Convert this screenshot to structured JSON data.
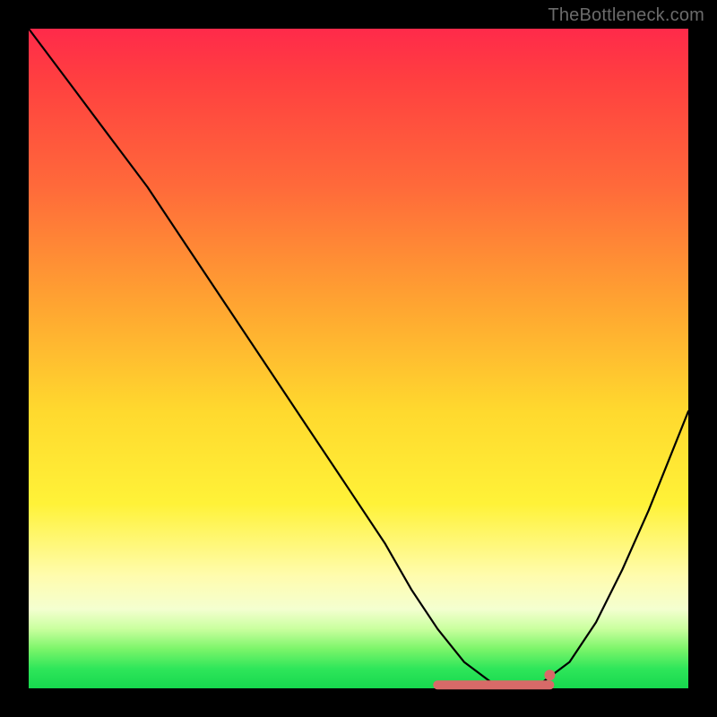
{
  "watermark": "TheBottleneck.com",
  "colors": {
    "frame": "#000000",
    "curve": "#000000",
    "fit_marker": "#d86a68",
    "gradient_top": "#ff2a4a",
    "gradient_bottom": "#16d84e"
  },
  "chart_data": {
    "type": "line",
    "title": "",
    "xlabel": "",
    "ylabel": "",
    "xlim": [
      0,
      100
    ],
    "ylim": [
      0,
      100
    ],
    "grid": false,
    "legend": false,
    "annotations": [
      "TheBottleneck.com"
    ],
    "series": [
      {
        "name": "bottleneck-curve",
        "x": [
          0,
          6,
          12,
          18,
          24,
          30,
          36,
          42,
          48,
          54,
          58,
          62,
          66,
          70,
          74,
          78,
          82,
          86,
          90,
          94,
          98,
          100
        ],
        "y": [
          100,
          92,
          84,
          76,
          67,
          58,
          49,
          40,
          31,
          22,
          15,
          9,
          4,
          1,
          0,
          1,
          4,
          10,
          18,
          27,
          37,
          42
        ]
      }
    ],
    "good_fit_range": {
      "x_start": 62,
      "x_end": 79,
      "y": 0.5
    },
    "good_fit_end_dot": {
      "x": 79,
      "y": 2
    }
  }
}
